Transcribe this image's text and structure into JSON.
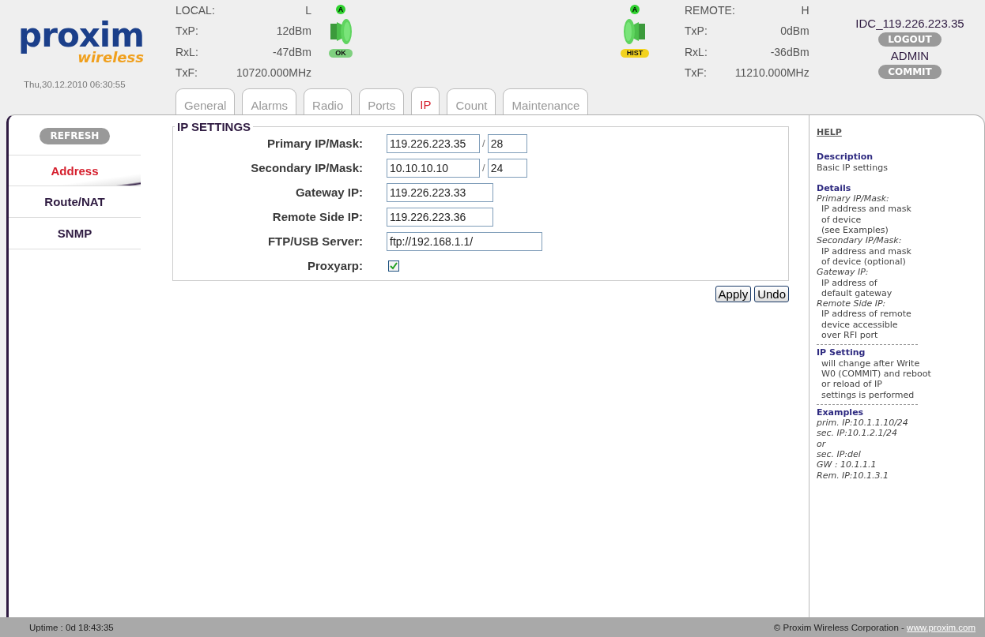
{
  "header": {
    "logo": {
      "brand": "proxim",
      "tagline": "wireless"
    },
    "datetime": "Thu,30.12.2010 06:30:55",
    "local": {
      "title": "LOCAL:",
      "mode": "L",
      "rows": [
        {
          "label": "TxP:",
          "value": "12dBm"
        },
        {
          "label": "RxL:",
          "value": "-47dBm"
        },
        {
          "label": "TxF:",
          "value": "10720.000MHz"
        }
      ]
    },
    "local_indicator": {
      "badge": "A",
      "status": "OK",
      "kind": "ok"
    },
    "remote_indicator": {
      "badge": "A",
      "status": "HIST",
      "kind": "hist"
    },
    "remote": {
      "title": "REMOTE:",
      "mode": "H",
      "rows": [
        {
          "label": "TxP:",
          "value": "0dBm"
        },
        {
          "label": "RxL:",
          "value": "-36dBm"
        },
        {
          "label": "TxF:",
          "value": "11210.000MHz"
        }
      ]
    },
    "device_name": "IDC_119.226.223.35",
    "logout_button": "LOGOUT",
    "user": "ADMIN",
    "commit_button": "COMMIT"
  },
  "tabs": [
    {
      "label": "General",
      "selected": false
    },
    {
      "label": "Alarms",
      "selected": false
    },
    {
      "label": "Radio",
      "selected": false
    },
    {
      "label": "Ports",
      "selected": false
    },
    {
      "label": "IP",
      "selected": true
    },
    {
      "label": "Count",
      "selected": false
    },
    {
      "label": "Maintenance",
      "selected": false
    }
  ],
  "sidebar": {
    "refresh_button": "REFRESH",
    "items": [
      {
        "label": "Address",
        "selected": true
      },
      {
        "label": "Route/NAT",
        "selected": false
      },
      {
        "label": "SNMP",
        "selected": false
      }
    ]
  },
  "ip_settings": {
    "legend": "IP SETTINGS",
    "fields": [
      {
        "kind": "ip_mask",
        "label": "Primary IP/Mask:",
        "value": "119.226.223.35",
        "separator": "/",
        "mask": "28"
      },
      {
        "kind": "ip_mask",
        "label": "Secondary IP/Mask:",
        "value": "10.10.10.10",
        "separator": "/",
        "mask": "24"
      },
      {
        "kind": "text",
        "label": "Gateway IP:",
        "value": "119.226.223.33"
      },
      {
        "kind": "text",
        "label": "Remote Side IP:",
        "value": "119.226.223.36"
      },
      {
        "kind": "wide",
        "label": "FTP/USB Server:",
        "value": "ftp://192.168.1.1/"
      },
      {
        "kind": "checkbox",
        "label": "Proxyarp:",
        "checked": true
      }
    ],
    "buttons": [
      "Apply",
      "Undo"
    ]
  },
  "help": {
    "title": "HELP",
    "lines": [
      {
        "kind": "heading",
        "text": "Description"
      },
      {
        "kind": "text",
        "text": "Basic IP settings"
      },
      {
        "kind": "gap"
      },
      {
        "kind": "heading",
        "text": "Details"
      },
      {
        "kind": "italic",
        "text": "Primary IP/Mask:"
      },
      {
        "kind": "sub",
        "text": "IP address and mask"
      },
      {
        "kind": "sub",
        "text": "of device"
      },
      {
        "kind": "sub",
        "text": "(see Examples)"
      },
      {
        "kind": "italic",
        "text": "Secondary IP/Mask:"
      },
      {
        "kind": "sub",
        "text": "IP address and mask"
      },
      {
        "kind": "sub",
        "text": "of device (optional)"
      },
      {
        "kind": "italic",
        "text": "Gateway IP:"
      },
      {
        "kind": "sub",
        "text": "IP address of"
      },
      {
        "kind": "sub",
        "text": "default gateway"
      },
      {
        "kind": "italic",
        "text": "Remote Side IP:"
      },
      {
        "kind": "sub",
        "text": "IP address of remote"
      },
      {
        "kind": "sub",
        "text": "device accessible"
      },
      {
        "kind": "sub",
        "text": "over RFI port"
      },
      {
        "kind": "rule"
      },
      {
        "kind": "heading",
        "text": "IP Setting"
      },
      {
        "kind": "sub",
        "text": "will change after Write"
      },
      {
        "kind": "sub",
        "text": "W0 (COMMIT) and reboot"
      },
      {
        "kind": "sub",
        "text": "or reload of IP"
      },
      {
        "kind": "sub",
        "text": "settings is performed"
      },
      {
        "kind": "rule"
      },
      {
        "kind": "heading",
        "text": "Examples"
      },
      {
        "kind": "italic",
        "text": "prim. IP:10.1.1.10/24"
      },
      {
        "kind": "italic",
        "text": "sec. IP:10.1.2.1/24"
      },
      {
        "kind": "italic",
        "text": "or"
      },
      {
        "kind": "italic",
        "text": "sec. IP:del"
      },
      {
        "kind": "italic",
        "text": "GW : 10.1.1.1"
      },
      {
        "kind": "italic",
        "text": "Rem. IP:10.1.3.1"
      }
    ]
  },
  "footer": {
    "uptime": "Uptime : 0d 18:43:35",
    "copyright": "© Proxim Wireless Corporation - ",
    "link": "www.proxim.com"
  }
}
